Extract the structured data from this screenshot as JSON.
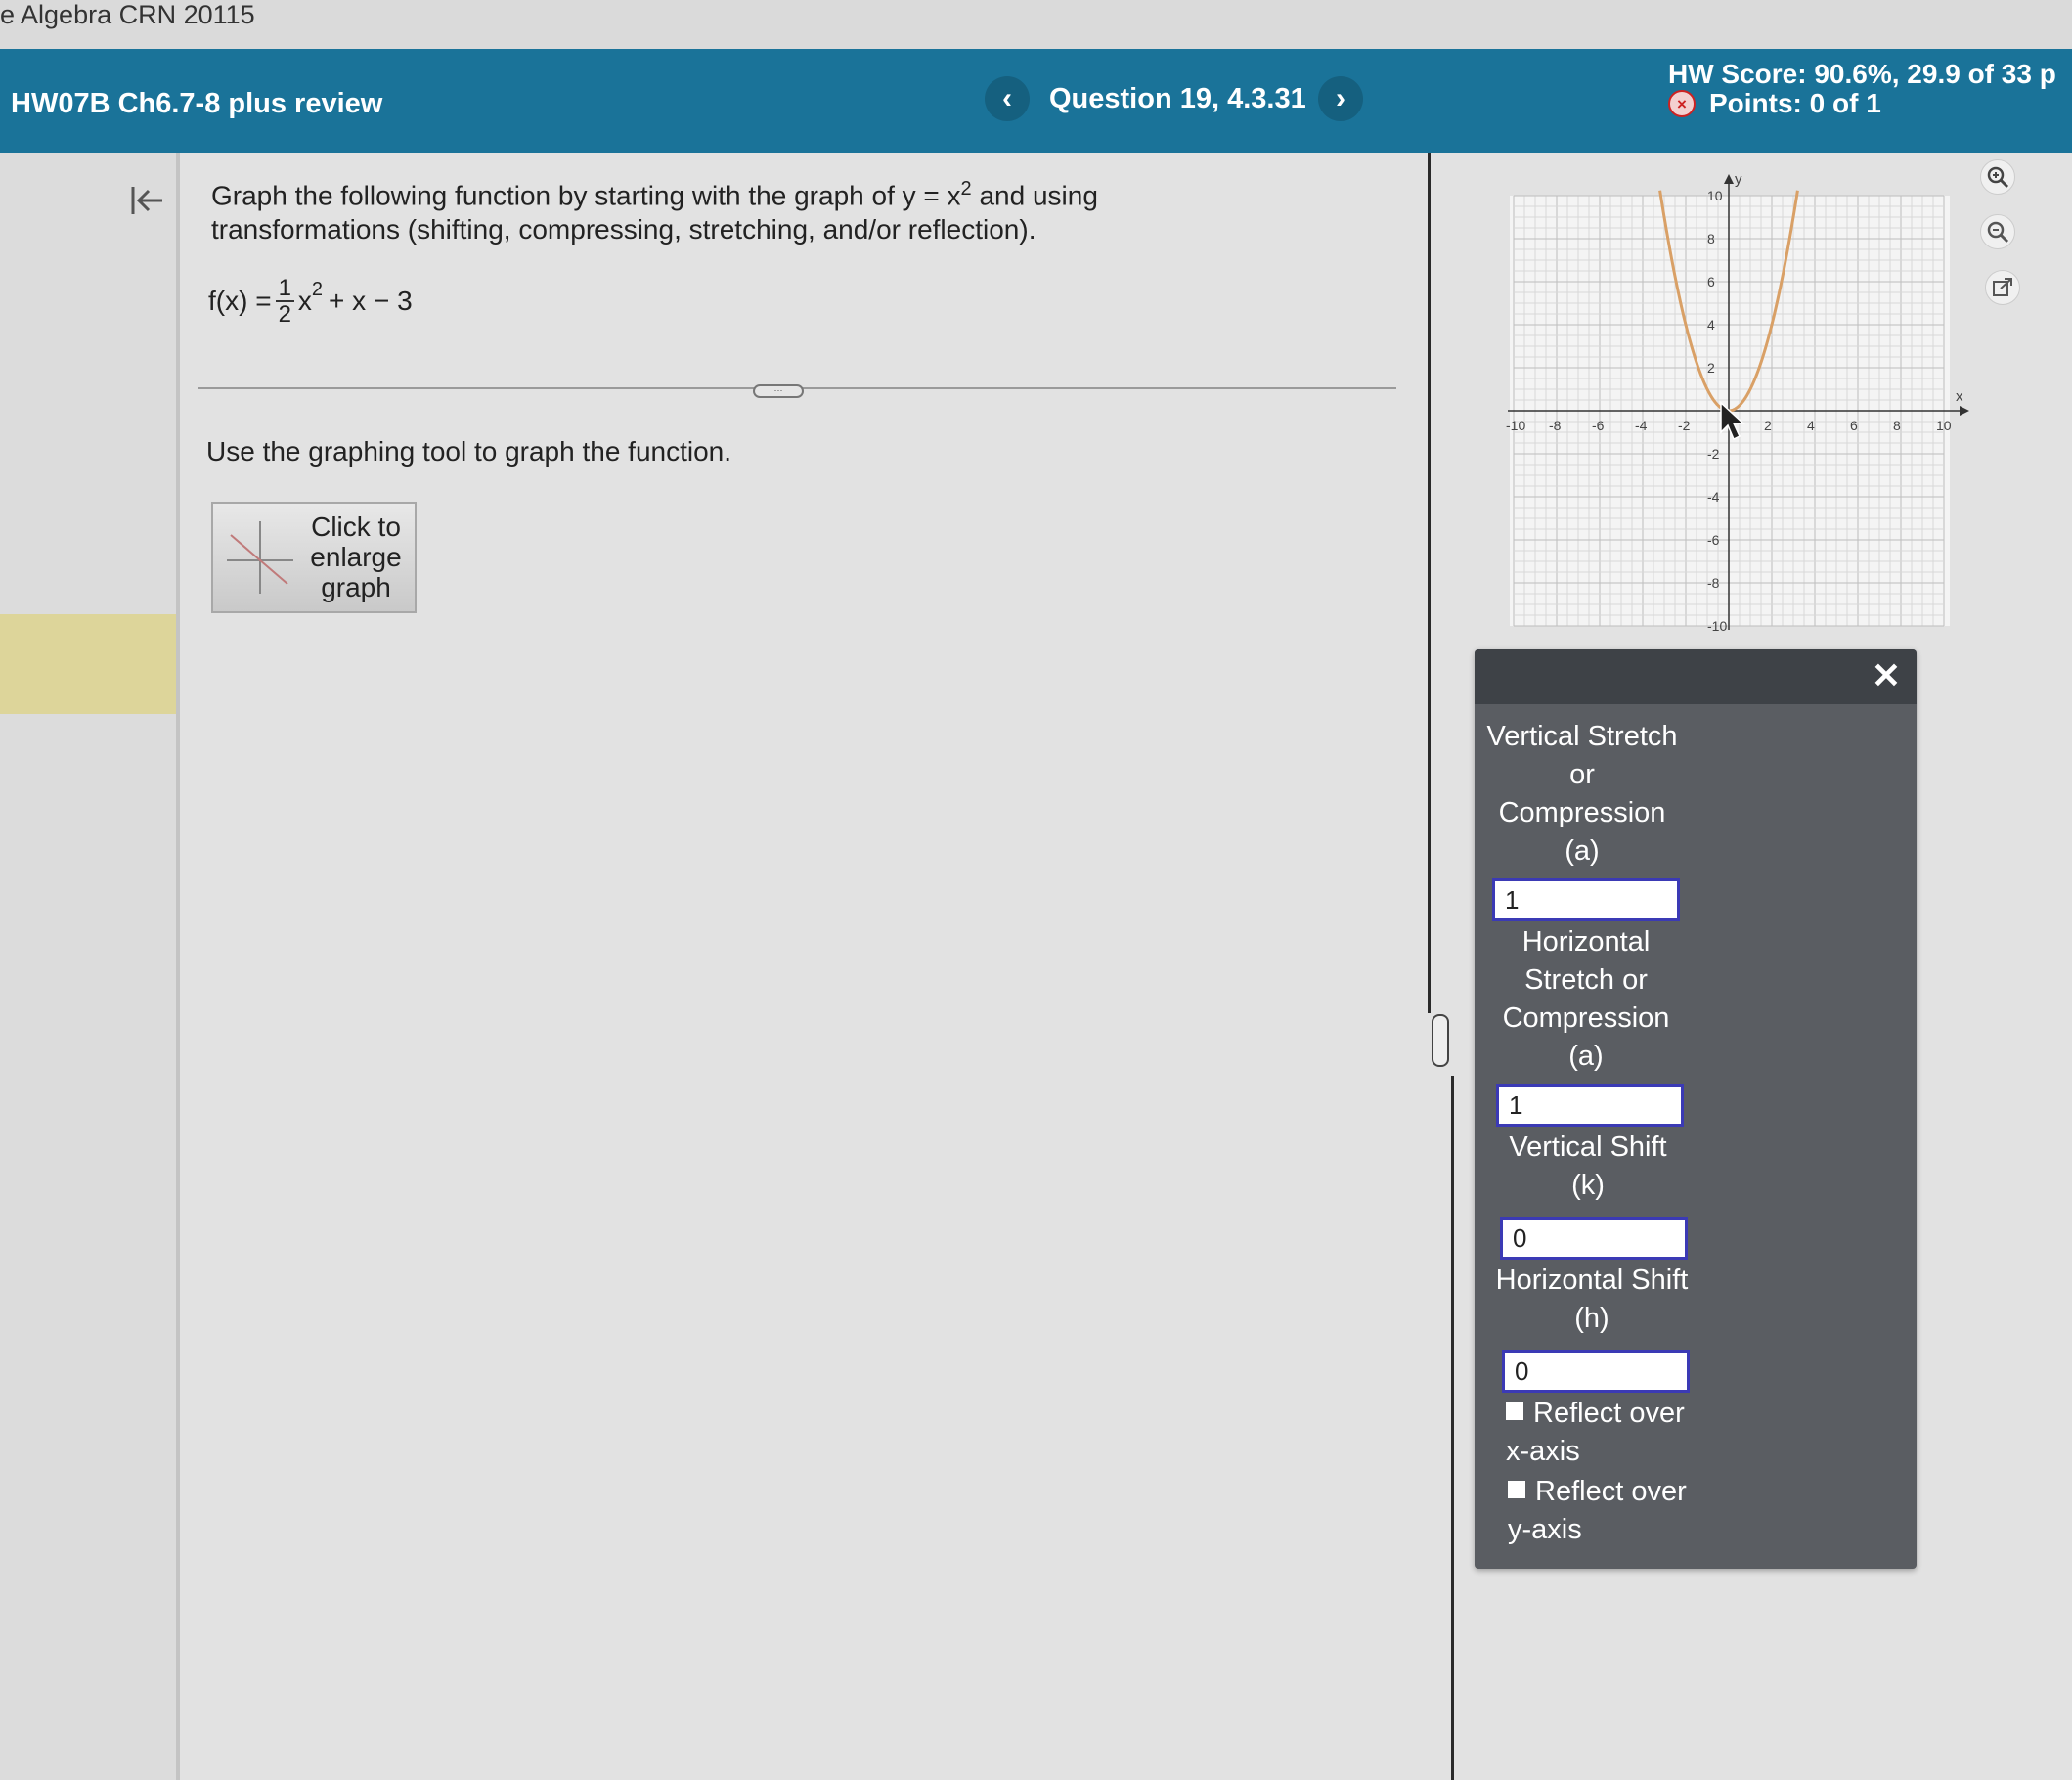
{
  "course": {
    "title": "e Algebra CRN 20115"
  },
  "header": {
    "assignment_title": "HW07B Ch6.7-8 plus review",
    "question_label": "Question 19, 4.3.31",
    "prev_label": "‹",
    "next_label": "›",
    "hw_score": "HW Score: 90.6%, 29.9 of 33 p",
    "points": "Points: 0 of 1",
    "wrong_mark": "×"
  },
  "sidebar": {
    "collapse_icon": "collapse-left-icon"
  },
  "question": {
    "prompt_part1": "Graph the following function by starting with the graph of y = x",
    "prompt_exp": "2",
    "prompt_part2": " and using transformations (shifting, compressing, stretching, and/or reflection).",
    "function_lhs": "f(x) = ",
    "function_frac_num": "1",
    "function_frac_den": "2",
    "function_var": "x",
    "function_exp": "2",
    "function_rest": "+ x − 3",
    "divider_handle": "⋯",
    "instruction": "Use the graphing tool to graph the function.",
    "enlarge_button": "Click to enlarge graph"
  },
  "graph": {
    "x_axis_label": "x",
    "y_axis_label": "y",
    "x_range": [
      -10,
      10
    ],
    "y_range": [
      -10,
      10
    ],
    "x_tick_labels": [
      "-10",
      "-8",
      "-6",
      "-4",
      "-2",
      "2",
      "4",
      "6",
      "8",
      "10"
    ],
    "y_tick_labels": [
      "10",
      "8",
      "6",
      "4",
      "2",
      "-2",
      "-4",
      "-6",
      "-8",
      "-10"
    ],
    "curve": "y = x^2",
    "curve_color": "#d9a066",
    "grid": true,
    "tools": [
      "zoom-in-icon",
      "zoom-out-icon",
      "popout-icon"
    ]
  },
  "panel": {
    "close_label": "✕",
    "vertical_stretch_label": "Vertical Stretch or Compression (a)",
    "vertical_stretch_value": "1",
    "horizontal_stretch_label": "Horizontal Stretch or Compression (a)",
    "horizontal_stretch_value": "1",
    "vertical_shift_label": "Vertical Shift (k)",
    "vertical_shift_value": "0",
    "horizontal_shift_label": "Horizontal Shift (h)",
    "horizontal_shift_value": "0",
    "reflect_x_label": "Reflect over x-axis",
    "reflect_y_label": "Reflect over y-axis",
    "reflect_x_checked": false,
    "reflect_y_checked": false
  }
}
